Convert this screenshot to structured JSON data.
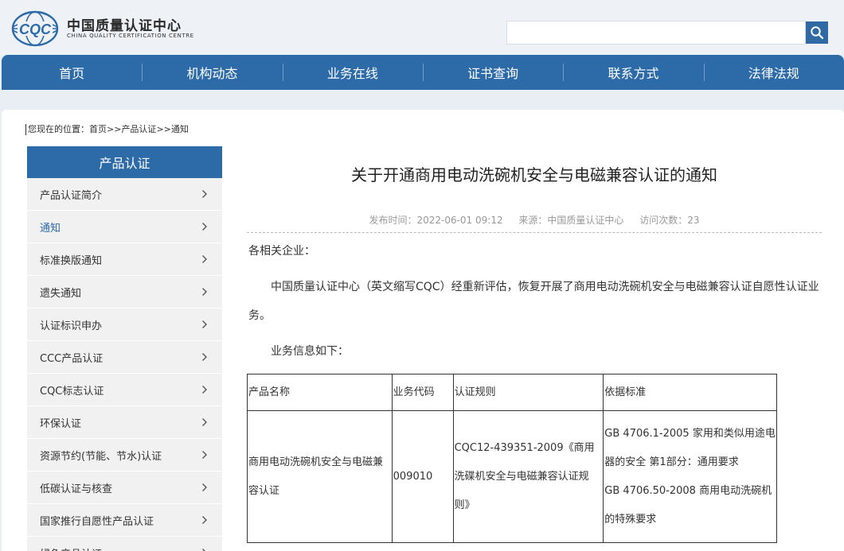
{
  "header": {
    "logo_text": "CQC",
    "org_name_cn": "中国质量认证中心",
    "org_name_en": "CHINA QUALITY CERTIFICATION CENTRE",
    "search": {
      "placeholder": "",
      "value": ""
    },
    "search_icon": "search-icon"
  },
  "nav": {
    "items": [
      "首页",
      "机构动态",
      "业务在线",
      "证书查询",
      "联系方式",
      "法律法规"
    ]
  },
  "breadcrumb": {
    "prefix": "您现在的位置：",
    "home": "首页",
    "sep1": ">>",
    "section": "产品认证",
    "sep2": ">>",
    "current": "通知"
  },
  "sidebar": {
    "title": "产品认证",
    "active_index": 1,
    "items": [
      {
        "label": "产品认证简介"
      },
      {
        "label": "通知"
      },
      {
        "label": "标准换版通知"
      },
      {
        "label": "遗失通知"
      },
      {
        "label": "认证标识申办"
      },
      {
        "label": "CCC产品认证"
      },
      {
        "label": "CQC标志认证"
      },
      {
        "label": "环保认证"
      },
      {
        "label": "资源节约(节能、节水)认证"
      },
      {
        "label": "低碳认证与核查"
      },
      {
        "label": "国家推行自愿性产品认证"
      },
      {
        "label": "绿色产品认证"
      }
    ]
  },
  "article": {
    "title": "关于开通商用电动洗碗机安全与电磁兼容认证的通知",
    "meta": {
      "published": "发布时间：2022-06-01 09:12",
      "source": "来源：中国质量认证中心",
      "visits": "访问次数：23"
    },
    "salutation": "各相关企业：",
    "paragraph1": "中国质量认证中心（英文缩写CQC）经重新评估，恢复开展了商用电动洗碗机安全与电磁兼容认证自愿性认证业务。",
    "paragraph2": "业务信息如下：",
    "table": {
      "headers": [
        "产品名称",
        "业务代码",
        "认证规则",
        "依据标准"
      ],
      "rows": [
        {
          "product": "商用电动洗碗机安全与电磁兼容认证",
          "code": "009010",
          "rule": "CQC12-439351-2009《商用洗碟机安全与电磁兼容认证规则》",
          "standard1": "GB 4706.1-2005 家用和类似用途电器的安全 第1部分：通用要求",
          "standard2": "GB 4706.50-2008 商用电动洗碗机的特殊要求"
        }
      ]
    }
  },
  "colors": {
    "brand_blue": "#2d6ba8",
    "header_bg": "#eef2f7",
    "sidebar_item_bg": "#f1f1f1"
  }
}
